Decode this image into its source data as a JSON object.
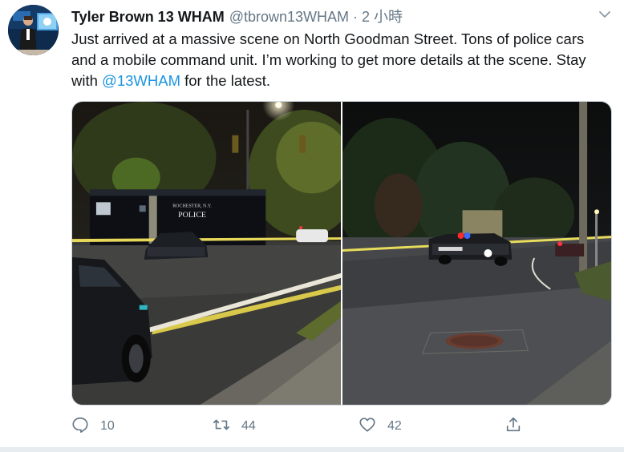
{
  "tweet": {
    "author_name": "Tyler Brown 13 WHAM",
    "author_handle": "@tbrown13WHAM",
    "separator": "·",
    "time": "2 小時",
    "text_before": "Just arrived at a massive scene on North Goodman Street. Tons of police cars and a mobile command unit. I’m working to get more details at the scene. Stay with ",
    "mention": "@13WHAM",
    "text_after": " for the latest.",
    "media": {
      "photo_1_sign_line1": "ROCHESTER, N.Y.",
      "photo_1_sign_line2": "POLICE"
    },
    "actions": {
      "reply_count": "10",
      "retweet_count": "44",
      "like_count": "42"
    },
    "icons": {
      "reply": "reply-icon",
      "retweet": "retweet-icon",
      "like": "heart-icon",
      "share": "share-icon",
      "menu": "chevron-down-icon"
    },
    "colors": {
      "link": "#1b95e0",
      "secondary_text": "#657786",
      "border": "#ccd6dd"
    }
  }
}
